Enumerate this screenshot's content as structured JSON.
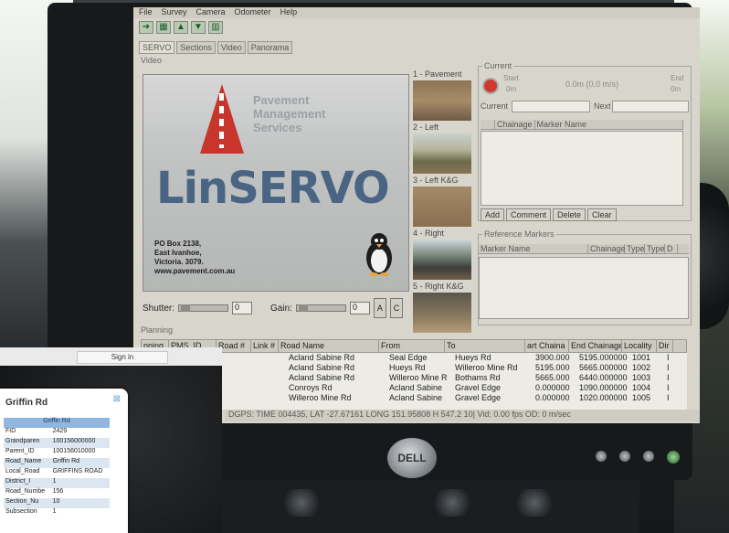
{
  "app": {
    "menu": [
      "File",
      "Survey",
      "Camera",
      "Odometer",
      "Help"
    ],
    "tabs": [
      "SERVO",
      "Sections",
      "Video",
      "Panorama"
    ],
    "video_group": "Video",
    "logo": {
      "company": [
        "Pavement",
        "Management",
        "Services"
      ],
      "product": "LinSERVO",
      "address": [
        "PO Box 2138,",
        "East Ivanhoe,",
        "Victoria. 3079.",
        "www.pavement.com.au"
      ]
    },
    "controls": {
      "shutter_label": "Shutter:",
      "shutter_value": "0",
      "gain_label": "Gain:",
      "gain_value": "0",
      "btn_a": "A",
      "btn_c": "C"
    },
    "thumbnails": [
      "1 - Pavement",
      "2 - Left",
      "3 - Left K&G",
      "4 - Right",
      "5 - Right K&G"
    ],
    "current": {
      "group": "Current",
      "start_label": "Start",
      "start_value": "0m",
      "distance": "0.0m (0.0 m/s)",
      "end_label": "End",
      "end_value": "0m",
      "current_label": "Current",
      "next_label": "Next",
      "table_headers": [
        "Chainage",
        "Marker Name"
      ],
      "buttons": [
        "Add",
        "Comment",
        "Delete",
        "Clear"
      ]
    },
    "reference": {
      "group": "Reference Markers",
      "headers": [
        "Marker Name",
        "Chainage",
        "Type",
        "Type",
        "D"
      ]
    },
    "planning": {
      "label": "Planning",
      "headers": [
        "nning",
        "PMS_ID",
        "Road #",
        "Link #",
        "Road Name",
        "From",
        "To",
        "art Chaina",
        "End Chainage",
        "Locality",
        "Dir"
      ],
      "rows": [
        [
          "Acland Sabine Rd",
          "Seal Edge",
          "Hueys Rd",
          "3900.000",
          "5195.000000",
          "1001",
          "I"
        ],
        [
          "Acland Sabine Rd",
          "Hueys Rd",
          "Willeroo Mine Rd",
          "5195.000",
          "5665.000000",
          "1002",
          "I"
        ],
        [
          "Acland Sabine Rd",
          "Willeroo Mine R",
          "Bothams Rd",
          "5665.000",
          "6440.000000",
          "1003",
          "I"
        ],
        [
          "Conroys Rd",
          "Acland Sabine",
          "Gravel Edge",
          "0.000000",
          "1090.000000",
          "1004",
          "I"
        ],
        [
          "Willeroo Mine Rd",
          "Acland Sabine",
          "Gravel Edge",
          "0.000000",
          "1020.000000",
          "1005",
          "I"
        ]
      ]
    },
    "status": "DGPS: TIME 004435, LAT -27.67161 LONG 151.95808 H 547.2 10| Vid: 0.00 fps  OD: 0 m/sec"
  },
  "monitor": {
    "brand": "DELL"
  },
  "phone": {
    "signin": "Sign in",
    "popup_title": "Griffin Rd",
    "popup_header": "Griffin Rd",
    "rows": [
      [
        "FID",
        "2429"
      ],
      [
        "Grandparen",
        "100156000000"
      ],
      [
        "Parent_ID",
        "100156010000"
      ],
      [
        "Road_Name",
        "Griffin Rd"
      ],
      [
        "Local_Road",
        "GRIFFINS ROAD"
      ],
      [
        "District_I",
        "1"
      ],
      [
        "Road_Numbe",
        "156"
      ],
      [
        "Section_Nu",
        "10"
      ],
      [
        "Subsection",
        "1"
      ]
    ]
  },
  "colors": {
    "record": "#cf3a2e",
    "logo_triangle": "#c8352a",
    "popup_header": "#8fb7df"
  }
}
